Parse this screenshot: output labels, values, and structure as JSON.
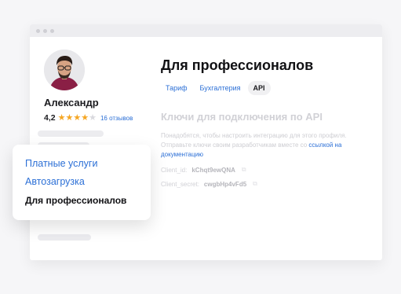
{
  "profile": {
    "name": "Александр",
    "rating": "4,2",
    "stars": [
      {
        "icon": "star-filled-icon",
        "color": "#f5a623",
        "char": "★"
      },
      {
        "icon": "star-filled-icon",
        "color": "#f5a623",
        "char": "★"
      },
      {
        "icon": "star-filled-icon",
        "color": "#f5a623",
        "char": "★"
      },
      {
        "icon": "star-filled-icon",
        "color": "#f5a623",
        "char": "★"
      },
      {
        "icon": "star-empty-icon",
        "color": "#d9d9de",
        "char": "★"
      }
    ],
    "reviews": "16 отзывов"
  },
  "main": {
    "title": "Для профессионалов",
    "tabs": [
      {
        "label": "Тариф",
        "active": false
      },
      {
        "label": "Бухгалтерия",
        "active": false
      },
      {
        "label": "API",
        "active": true
      }
    ],
    "section_title": "Ключи для подключения по API",
    "description": "Понадобятся, чтобы настроить интеграцию для этого профиля. Отправьте ключи своим разработчикам вместе со",
    "description_link": "ссылкой на документацию",
    "client_id_label": "Client_id:",
    "client_id_value": "kChqt9ewQNA",
    "client_secret_label": "Client_secret:",
    "client_secret_value": "cwgbHp4vFd5"
  },
  "menu": {
    "items": [
      {
        "label": "Платные услуги",
        "current": false
      },
      {
        "label": "Автозагрузка",
        "current": false
      },
      {
        "label": "Для профессионалов",
        "current": true
      }
    ]
  },
  "colors": {
    "accent": "#2b6fd6",
    "star": "#f5a623"
  }
}
